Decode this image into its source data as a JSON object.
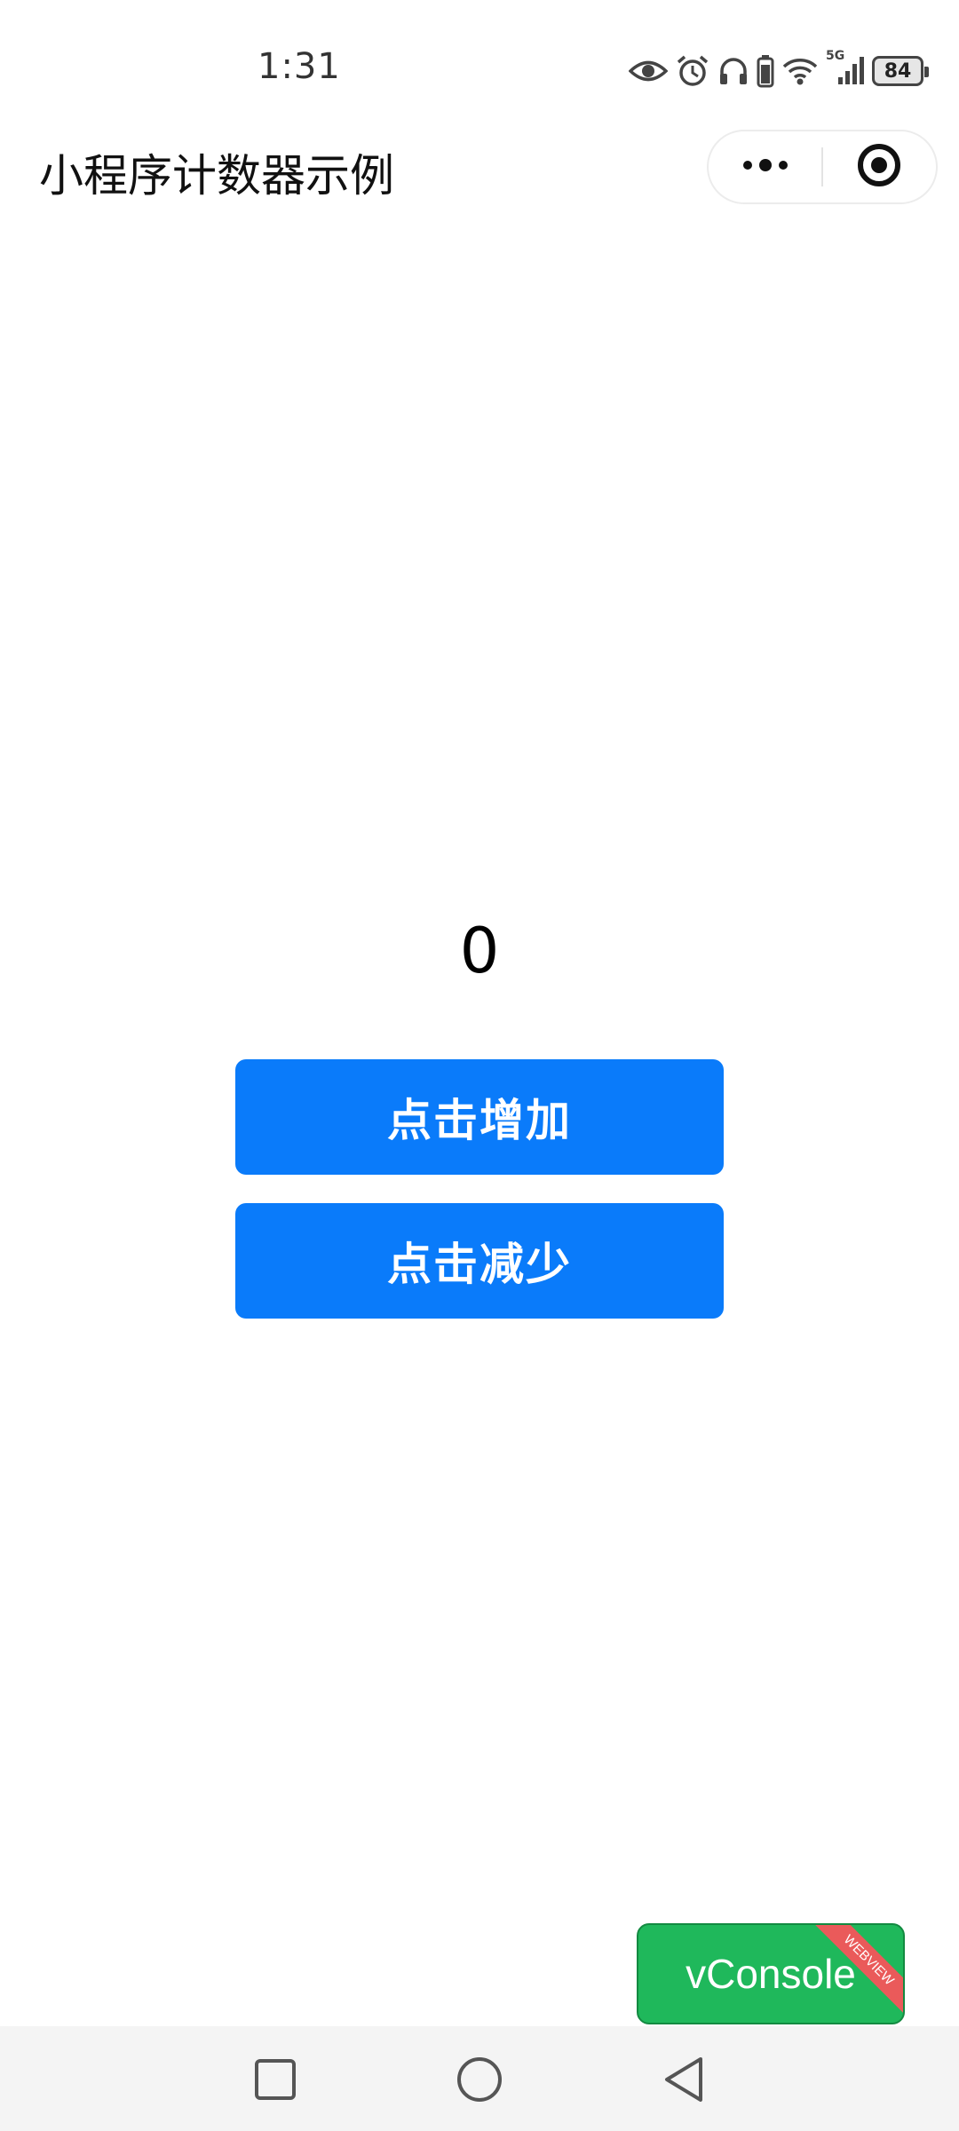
{
  "status_bar": {
    "time": "1:31",
    "battery_level": "84",
    "network_label": "5G",
    "icons": [
      "eye-icon",
      "alarm-icon",
      "headphones-icon",
      "phone-battery-icon",
      "wifi-icon",
      "cellular-signal-icon",
      "battery-icon"
    ]
  },
  "nav": {
    "title": "小程序计数器示例",
    "capsule": {
      "more_icon": "more-dots-icon",
      "close_icon": "target-close-icon"
    }
  },
  "main": {
    "counter_value": "0",
    "increment_label": "点击增加",
    "decrement_label": "点击减少",
    "button_color": "#0a7bfa"
  },
  "vconsole": {
    "label": "vConsole",
    "ribbon": "WEBVIEW",
    "color": "#1fb85b"
  },
  "bottom_nav": {
    "items": [
      "recent-apps-icon",
      "home-icon",
      "back-icon"
    ]
  }
}
